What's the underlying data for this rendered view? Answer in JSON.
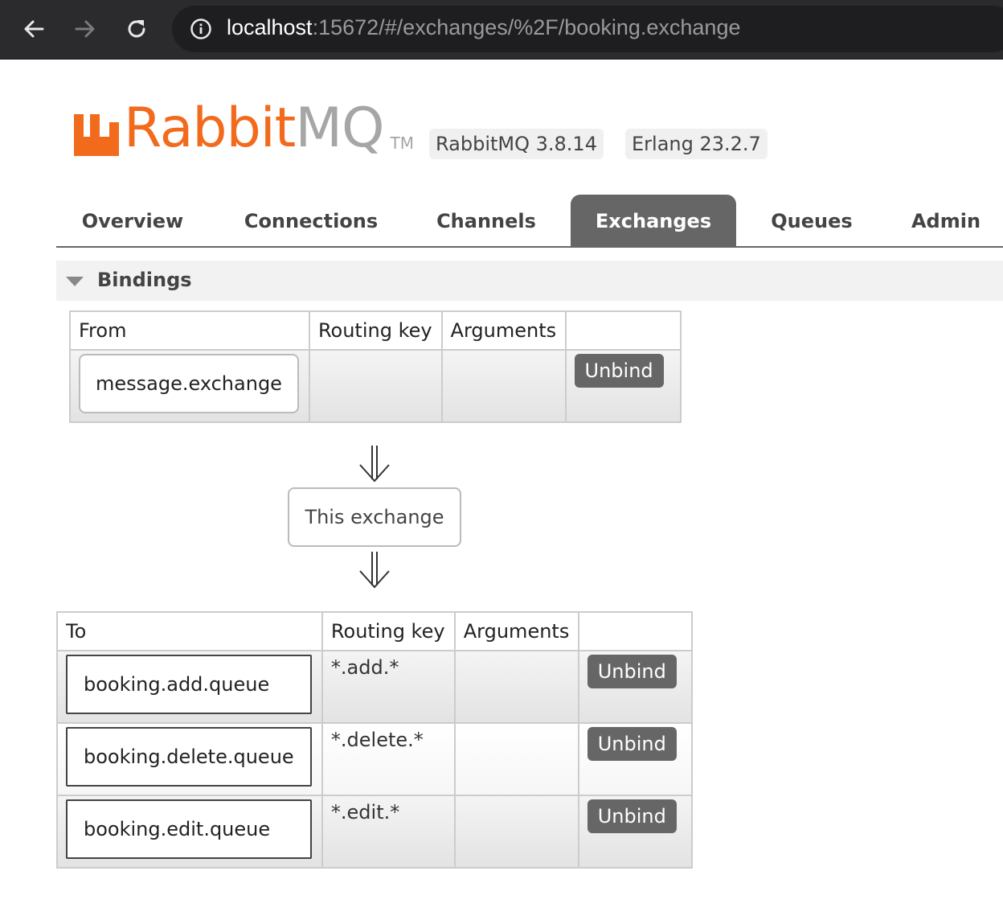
{
  "browser": {
    "url_host": "localhost",
    "url_rest": ":15672/#/exchanges/%2F/booking.exchange",
    "icons": {
      "back": "back-arrow-icon",
      "forward": "forward-arrow-icon",
      "reload": "reload-icon",
      "info": "info-icon"
    }
  },
  "header": {
    "logo_rabbit": "Rabbit",
    "logo_mq": "MQ",
    "logo_tm": "TM",
    "version": "RabbitMQ 3.8.14",
    "erlang": "Erlang 23.2.7"
  },
  "tabs": [
    {
      "label": "Overview",
      "active": false
    },
    {
      "label": "Connections",
      "active": false
    },
    {
      "label": "Channels",
      "active": false
    },
    {
      "label": "Exchanges",
      "active": true
    },
    {
      "label": "Queues",
      "active": false
    },
    {
      "label": "Admin",
      "active": false
    }
  ],
  "bindings": {
    "title": "Bindings",
    "from_table": {
      "headers": [
        "From",
        "Routing key",
        "Arguments",
        ""
      ],
      "rows": [
        {
          "source": "message.exchange",
          "routing_key": "",
          "arguments": "",
          "action": "Unbind"
        }
      ]
    },
    "this_exchange": "This exchange",
    "to_table": {
      "headers": [
        "To",
        "Routing key",
        "Arguments",
        ""
      ],
      "rows": [
        {
          "destination": "booking.add.queue",
          "routing_key": "*.add.*",
          "arguments": "",
          "action": "Unbind"
        },
        {
          "destination": "booking.delete.queue",
          "routing_key": "*.delete.*",
          "arguments": "",
          "action": "Unbind"
        },
        {
          "destination": "booking.edit.queue",
          "routing_key": "*.edit.*",
          "arguments": "",
          "action": "Unbind"
        }
      ]
    }
  },
  "colors": {
    "brand_orange": "#f26b1d",
    "tab_active": "#666666",
    "chrome_bg": "#2b2b2d"
  }
}
